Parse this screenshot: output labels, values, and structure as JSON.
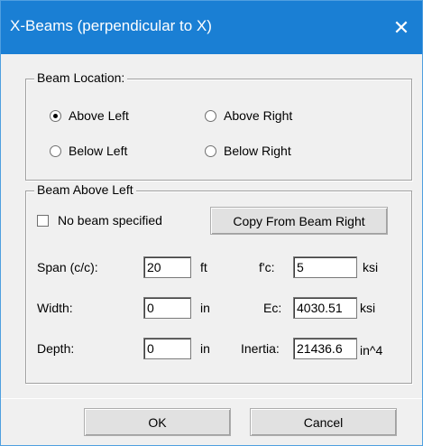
{
  "window": {
    "title": "X-Beams (perpendicular to X)",
    "close_glyph": "✕"
  },
  "beam_location": {
    "legend": "Beam Location:",
    "options": [
      {
        "label": "Above Left",
        "checked": true
      },
      {
        "label": "Above Right",
        "checked": false
      },
      {
        "label": "Below Left",
        "checked": false
      },
      {
        "label": "Below Right",
        "checked": false
      }
    ]
  },
  "beam_panel": {
    "legend": "Beam Above Left",
    "no_beam_label": "No beam specified",
    "no_beam_checked": false,
    "copy_button": "Copy From Beam Right",
    "span": {
      "label": "Span (c/c):",
      "value": "20",
      "unit": "ft"
    },
    "width": {
      "label": "Width:",
      "value": "0",
      "unit": "in"
    },
    "depth": {
      "label": "Depth:",
      "value": "0",
      "unit": "in"
    },
    "fc": {
      "label": "f'c:",
      "value": "5",
      "unit": "ksi"
    },
    "ec": {
      "label": "Ec:",
      "value": "4030.51",
      "unit": "ksi"
    },
    "inertia": {
      "label": "Inertia:",
      "value": "21436.6",
      "unit": "in^4"
    }
  },
  "buttons": {
    "ok": "OK",
    "cancel": "Cancel"
  },
  "colors": {
    "titlebar": "#1a7fd4",
    "dialog_bg": "#f0f0f0"
  }
}
